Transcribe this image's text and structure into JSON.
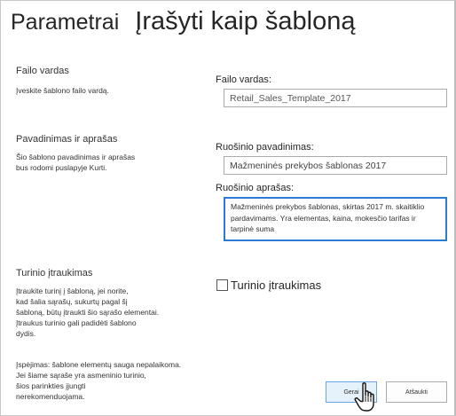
{
  "header": {
    "breadcrumb_root": "Parametrai",
    "title": "Įrašyti kaip šabloną"
  },
  "sections": {
    "file_name": {
      "heading": "Failo vardas",
      "description": "Įveskite šablono failo vardą.",
      "field_label": "Failo vardas:",
      "field_value": "Retail_Sales_Template_2017"
    },
    "name_description": {
      "heading": "Pavadinimas ir aprašas",
      "description_lines": [
        "Šio šablono pavadinimas ir aprašas",
        "bus rodomi puslapyje Kurti."
      ],
      "name_label": "Ruošinio pavadinimas:",
      "name_value": "Mažmeninės prekybos šablonas 2017",
      "desc_label": "Ruošinio aprašas:",
      "desc_value": "Mažmeninės prekybos šablonas, skirtas 2017 m. skaitiklio pardavimams. Yra elementas, kaina, mokesčio tarifas ir tarpinė suma"
    },
    "include_content": {
      "heading": "Turinio įtraukimas",
      "description_lines": [
        "Įtraukite turinį į šabloną, jei norite,",
        "kad šalia sąrašų, sukurtų pagal šį",
        "šabloną, būtų įtraukti šio sąrašo elementai.",
        "Įtraukus turinio gali padidėti šablono",
        "dydis."
      ],
      "warning_lines": [
        "Įspėjimas: šablone elementų sauga nepalaikoma.",
        "Jei šiame sąraše yra asmeninio turinio,",
        "šios parinkties įjungti",
        "nerekomenduojama."
      ],
      "checkbox_label": "Turinio įtraukimas"
    }
  },
  "buttons": {
    "ok": "Gerai",
    "cancel": "Atšaukti"
  }
}
